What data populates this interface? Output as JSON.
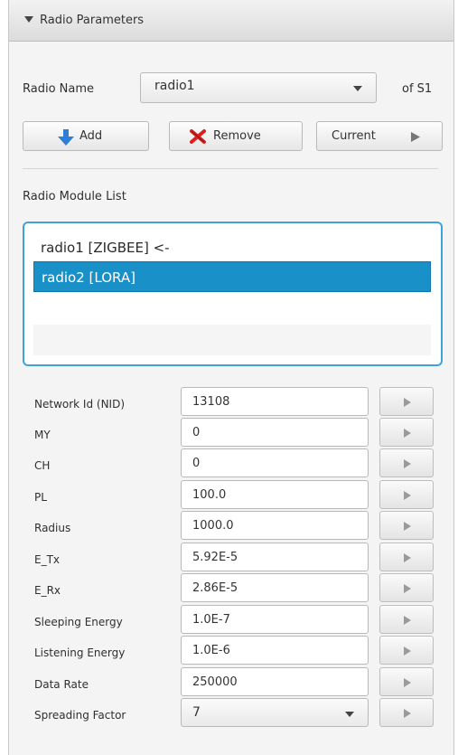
{
  "header": {
    "title": "Radio Parameters"
  },
  "radio": {
    "name_label": "Radio Name",
    "selected": "radio1",
    "of_label": "of S1"
  },
  "buttons": {
    "add": "Add",
    "remove": "Remove",
    "current": "Current"
  },
  "module_list": {
    "label": "Radio Module List",
    "items": [
      {
        "text": "radio1 [ZIGBEE] <-",
        "selected": false
      },
      {
        "text": "radio2 [LORA]",
        "selected": true
      }
    ]
  },
  "fields": [
    {
      "label": "Network Id (NID)",
      "value": "13108"
    },
    {
      "label": "MY",
      "value": "0"
    },
    {
      "label": "CH",
      "value": "0"
    },
    {
      "label": "PL",
      "value": "100.0"
    },
    {
      "label": "Radius",
      "value": "1000.0"
    },
    {
      "label": "E_Tx",
      "value": "5.92E-5"
    },
    {
      "label": "E_Rx",
      "value": "2.86E-5"
    },
    {
      "label": "Sleeping Energy",
      "value": "1.0E-7"
    },
    {
      "label": "Listening Energy",
      "value": "1.0E-6"
    },
    {
      "label": "Data Rate",
      "value": "250000"
    },
    {
      "label": "Spreading Factor",
      "value": "7"
    }
  ],
  "icons": {
    "add": "down-arrow-icon",
    "remove": "red-x-icon",
    "current": "play-icon"
  },
  "colors": {
    "accent": "#1990c8",
    "focus_border": "#3fa3d8",
    "add_icon": "#2f7fd6",
    "remove_icon": "#d82020"
  }
}
